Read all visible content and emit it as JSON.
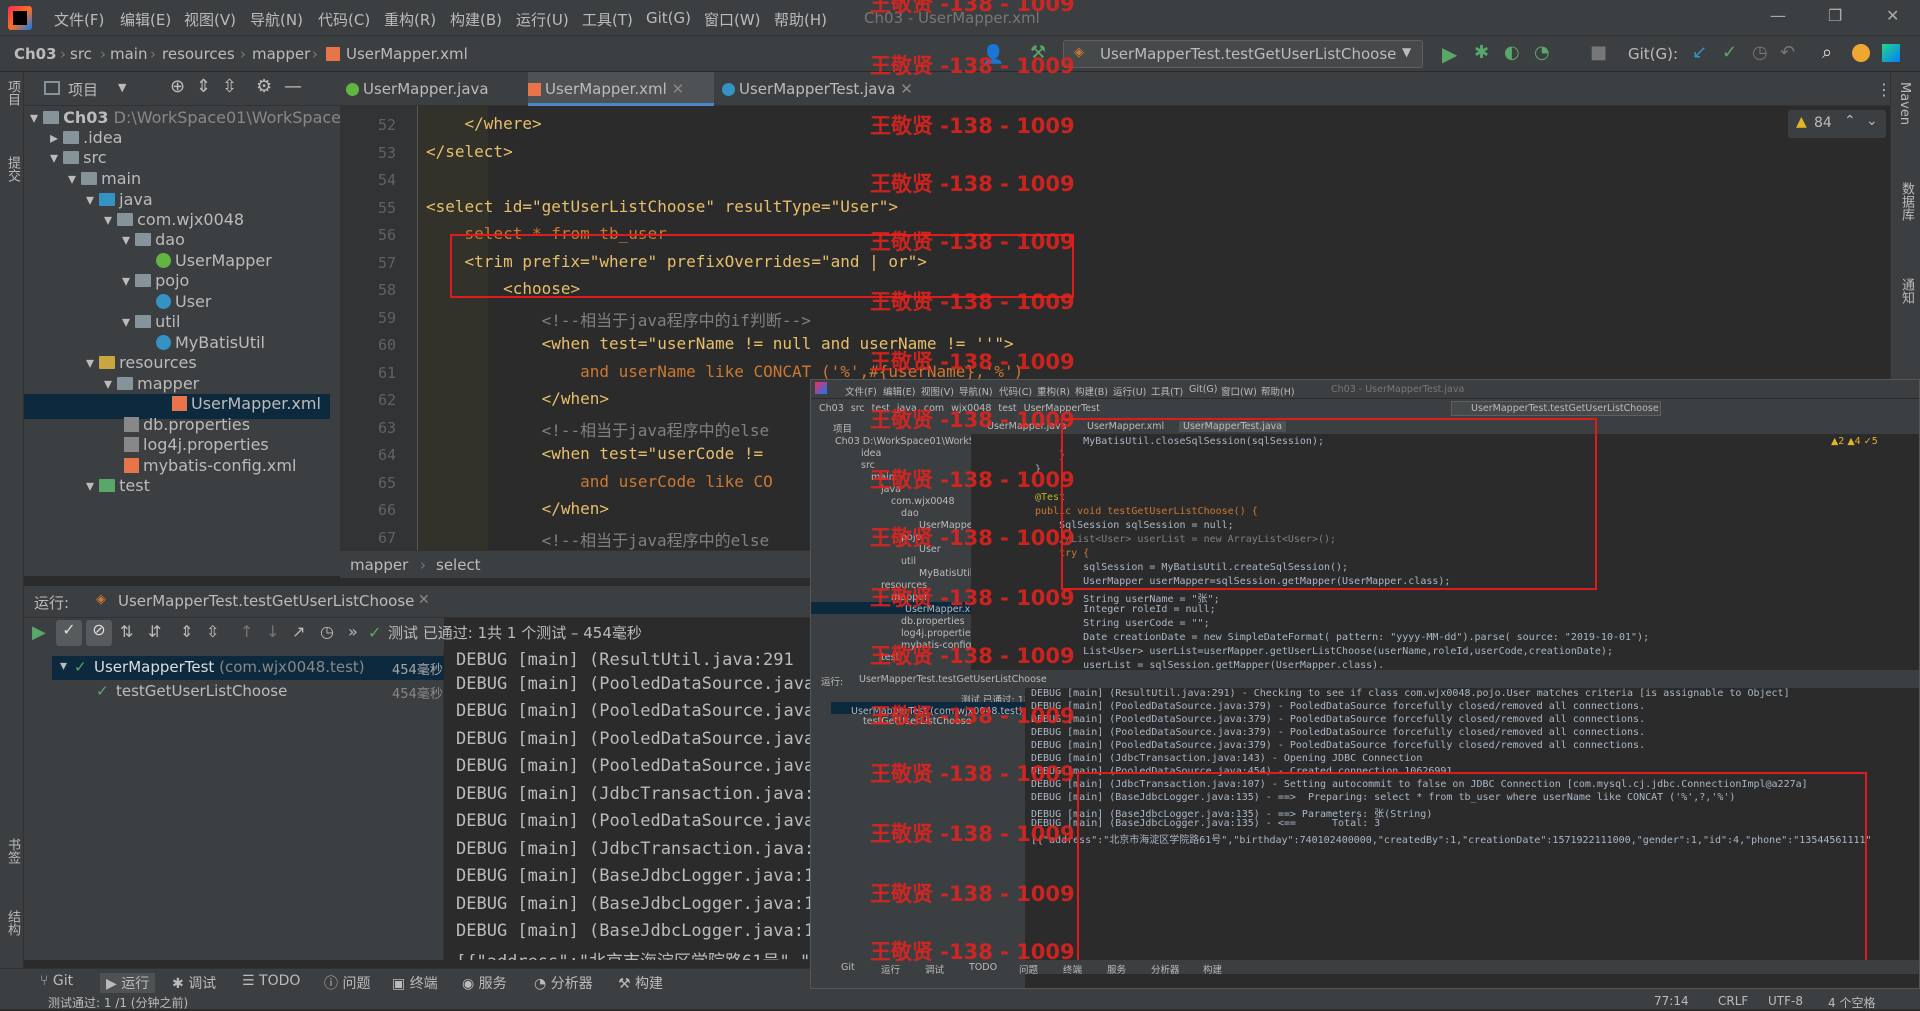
{
  "window": {
    "title": "Ch03 - UserMapper.xml"
  },
  "menu": [
    "文件(F)",
    "编辑(E)",
    "视图(V)",
    "导航(N)",
    "代码(C)",
    "重构(R)",
    "构建(B)",
    "运行(U)",
    "工具(T)",
    "Git(G)",
    "窗口(W)",
    "帮助(H)"
  ],
  "breadcrumb": [
    "Ch03",
    "src",
    "main",
    "resources",
    "mapper",
    "UserMapper.xml"
  ],
  "run_config": "UserMapperTest.testGetUserListChoose",
  "git_label": "Git(G):",
  "tabs": [
    "UserMapper.java",
    "UserMapper.xml",
    "UserMapperTest.java"
  ],
  "project_panel_title": "项目",
  "tree": [
    {
      "label": "Ch03",
      "path": "D:\\WorkSpace01\\WorkSpace"
    },
    {
      "label": ".idea"
    },
    {
      "label": "src"
    },
    {
      "label": "main"
    },
    {
      "label": "java"
    },
    {
      "label": "com.wjx0048"
    },
    {
      "label": "dao"
    },
    {
      "label": "UserMapper"
    },
    {
      "label": "pojo"
    },
    {
      "label": "User"
    },
    {
      "label": "util"
    },
    {
      "label": "MyBatisUtil"
    },
    {
      "label": "resources"
    },
    {
      "label": "mapper"
    },
    {
      "label": "UserMapper.xml"
    },
    {
      "label": "db.properties"
    },
    {
      "label": "log4j.properties"
    },
    {
      "label": "mybatis-config.xml"
    },
    {
      "label": "test"
    }
  ],
  "warnings_count": "84",
  "code_lines": [
    {
      "n": "52",
      "text": "    </where>"
    },
    {
      "n": "53",
      "text": "</select>"
    },
    {
      "n": "54",
      "text": ""
    },
    {
      "n": "55",
      "text": "<select id=\"getUserListChoose\" resultType=\"User\">"
    },
    {
      "n": "56",
      "text": "    select * from tb_user"
    },
    {
      "n": "57",
      "text": "    <trim prefix=\"where\" prefixOverrides=\"and | or\">"
    },
    {
      "n": "58",
      "text": "        <choose>"
    },
    {
      "n": "59",
      "text": "            <!--相当于java程序中的if判断-->"
    },
    {
      "n": "60",
      "text": "            <when test=\"userName != null and userName != ''\">"
    },
    {
      "n": "61",
      "text": "                and userName like CONCAT ('%',#{userName},'%')"
    },
    {
      "n": "62",
      "text": "            </when>"
    },
    {
      "n": "63",
      "text": "            <!--相当于java程序中的else"
    },
    {
      "n": "64",
      "text": "            <when test=\"userCode !="
    },
    {
      "n": "65",
      "text": "                and userCode like CO"
    },
    {
      "n": "66",
      "text": "            </when>"
    },
    {
      "n": "67",
      "text": "            <!--相当于java程序中的else"
    }
  ],
  "editor_footer": [
    "mapper",
    "select"
  ],
  "run_panel": {
    "label": "运行:",
    "tab": "UserMapperTest.testGetUserListChoose",
    "status": "测试 已通过: 1共 1 个测试 – 454毫秒"
  },
  "run_tree": [
    {
      "label": "UserMapperTest",
      "pkg": "(com.wjx0048.test)",
      "time": "454毫秒"
    },
    {
      "label": "testGetUserListChoose",
      "time": "454毫秒"
    }
  ],
  "console_lines": [
    "DEBUG [main] (ResultUtil.java:291",
    "DEBUG [main] (PooledDataSource.java",
    "DEBUG [main] (PooledDataSource.java",
    "DEBUG [main] (PooledDataSource.java",
    "DEBUG [main] (PooledDataSource.java",
    "DEBUG [main] (JdbcTransaction.java:1",
    "DEBUG [main] (PooledDataSource.java",
    "DEBUG [main] (JdbcTransaction.java:1",
    "DEBUG [main] (BaseJdbcLogger.java:13",
    "DEBUG [main] (BaseJdbcLogger.java:13",
    "DEBUG [main] (BaseJdbcLogger.java:13",
    "[{\"address\":\"北京市海淀区学院路61号\",\"b"
  ],
  "bottom_tools": [
    "Git",
    "运行",
    "调试",
    "TODO",
    "问题",
    "终端",
    "服务",
    "分析器",
    "构建"
  ],
  "status_bar": {
    "left": "测试通过: 1 /1 (分钟之前)",
    "pos": "77:14",
    "eol": "CRLF",
    "enc": "UTF-8",
    "indent": "4 个空格"
  },
  "watermark": "王敬贤 -138 - 1009",
  "right_labels": [
    "Maven",
    "数据库",
    "通知"
  ],
  "left_labels": [
    "项目",
    "提交",
    "书签",
    "结构"
  ],
  "inset": {
    "title": "Ch03 - UserMapperTest.java",
    "crumbs": "Ch03  src  test  java  com  wjx0048  test  UserMapperTest",
    "run_config": "UserMapperTest.testGetUserListChoose",
    "tabs": [
      "UserMapper.java",
      "UserMapper.xml",
      "UserMapperTest.java"
    ],
    "warn": "▲2 ▲4 ✓5",
    "tree": [
      "Ch03 D:\\WorkSpace01\\WorkSpac",
      "idea",
      "src",
      "main",
      "java",
      "com.wjx0048",
      "dao",
      "UserMapper",
      "pojo",
      "User",
      "util",
      "MyBatisUtil",
      "resources",
      "mapper",
      "UserMapper.xml",
      "db.properties",
      "log4j.properties",
      "mybatis-config.xml",
      "test"
    ],
    "code_nums": [
      "90",
      "91",
      "92",
      "93",
      "94",
      "95",
      "96",
      "97",
      "98",
      "99",
      "100",
      "101",
      "102",
      "103",
      "104",
      "105",
      "106"
    ],
    "code": [
      "        MyBatisUtil.closeSqlSession(sqlSession);",
      "    }",
      "}",
      "",
      "@Test",
      "public void testGetUserListChoose() {",
      "    SqlSession sqlSession = null;",
      "    //List<User> userList = new ArrayList<User>();",
      "    try {",
      "        sqlSession = MyBatisUtil.createSqlSession();",
      "        UserMapper userMapper=sqlSession.getMapper(UserMapper.class);",
      "        String userName = \"张\";",
      "        Integer roleId = null;",
      "        String userCode = \"\";",
      "        Date creationDate = new SimpleDateFormat( pattern: \"yyyy-MM-dd\").parse( source: \"2019-10-01\");",
      "        List<User> userList=userMapper.getUserListChoose(userName,roleId,userCode,creationDate);",
      "        userList = sqlSession.getMapper(UserMapper.class)."
    ],
    "run_tab": "UserMapperTest.testGetUserListChoose",
    "run_status": "测试 已通过: 1共 1 个测试 – 454毫秒",
    "run_tree": [
      "UserMapperTest (com.wjx0048.test) 454毫",
      "testGetUserListChoose"
    ],
    "console": [
      "DEBUG [main] (ResultUtil.java:291) - Checking to see if class com.wjx0048.pojo.User matches criteria [is assignable to Object]",
      "DEBUG [main] (PooledDataSource.java:379) - PooledDataSource forcefully closed/removed all connections.",
      "DEBUG [main] (PooledDataSource.java:379) - PooledDataSource forcefully closed/removed all connections.",
      "DEBUG [main] (PooledDataSource.java:379) - PooledDataSource forcefully closed/removed all connections.",
      "DEBUG [main] (PooledDataSource.java:379) - PooledDataSource forcefully closed/removed all connections.",
      "DEBUG [main] (JdbcTransaction.java:143) - Opening JDBC Connection",
      "DEBUG [main] (PooledDataSource.java:454) - Created connection 10626991.",
      "DEBUG [main] (JdbcTransaction.java:107) - Setting autocommit to false on JDBC Connection [com.mysql.cj.jdbc.ConnectionImpl@a227a]",
      "DEBUG [main] (BaseJdbcLogger.java:135) - ==>  Preparing: select * from tb_user where userName like CONCAT ('%',?,'%')",
      "DEBUG [main] (BaseJdbcLogger.java:135) - ==> Parameters: 张(String)",
      "DEBUG [main] (BaseJdbcLogger.java:135) - <==      Total: 3",
      "[{\"address\":\"北京市海淀区学院路61号\",\"birthday\":740102400000,\"createdBy\":1,\"creationDate\":1571922111000,\"gender\":1,\"id\":4,\"phone\":\"13544561111\""
    ],
    "bottom": [
      "Git",
      "运行",
      "调试",
      "TODO",
      "问题",
      "终端",
      "服务",
      "分析器",
      "构建"
    ]
  }
}
